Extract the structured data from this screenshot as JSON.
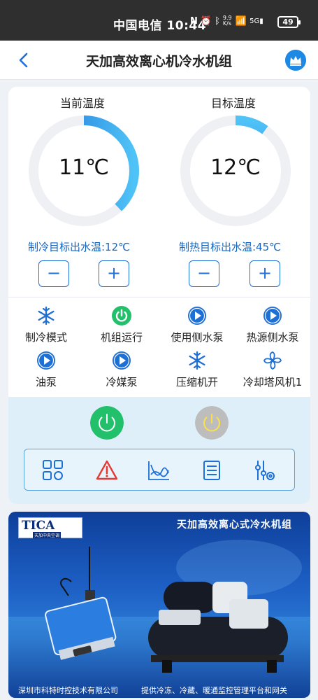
{
  "status_bar": {
    "carrier_time": "中国电信 10:44",
    "net_speed": "9.9 K/s",
    "battery": "49"
  },
  "header": {
    "title": "天加高效离心机冷水机组"
  },
  "gauges": {
    "current": {
      "label": "当前温度",
      "value": "11℃",
      "fill_fraction": 0.38
    },
    "target": {
      "label": "目标温度",
      "value": "12℃",
      "fill_fraction": 0.1
    }
  },
  "setpoints": {
    "cooling": "制冷目标出水温:12℃",
    "heating": "制热目标出水温:45℃"
  },
  "stepper": {
    "minus": "−",
    "plus": "+"
  },
  "status_items": [
    {
      "label": "制冷模式",
      "icon": "snowflake-icon"
    },
    {
      "label": "机组运行",
      "icon": "power-icon"
    },
    {
      "label": "使用侧水泵",
      "icon": "play-icon"
    },
    {
      "label": "热源侧水泵",
      "icon": "play-icon"
    },
    {
      "label": "油泵",
      "icon": "play-icon"
    },
    {
      "label": "冷媒泵",
      "icon": "play-icon"
    },
    {
      "label": "压缩机开",
      "icon": "snowflake-icon"
    },
    {
      "label": "冷却塔风机1",
      "icon": "fan-icon"
    }
  ],
  "colors": {
    "accent": "#1e6fd6",
    "gauge_track": "#eef0f3",
    "power_on": "#22c06a",
    "power_off": "#bdbdbd",
    "alarm": "#e53935",
    "panel_bg": "#deeff9"
  },
  "toolbar": [
    "grid-icon",
    "alarm-icon",
    "chart-icon",
    "list-icon",
    "settings-sliders-icon"
  ],
  "banner": {
    "logo": "TICA",
    "logo_sub": "天加中央空调",
    "title": "天加高效离心式冷水机组",
    "footer_left": "深圳市科特时控技术有限公司",
    "footer_right": "提供冷冻、冷藏、暖通监控管理平台和网关"
  }
}
